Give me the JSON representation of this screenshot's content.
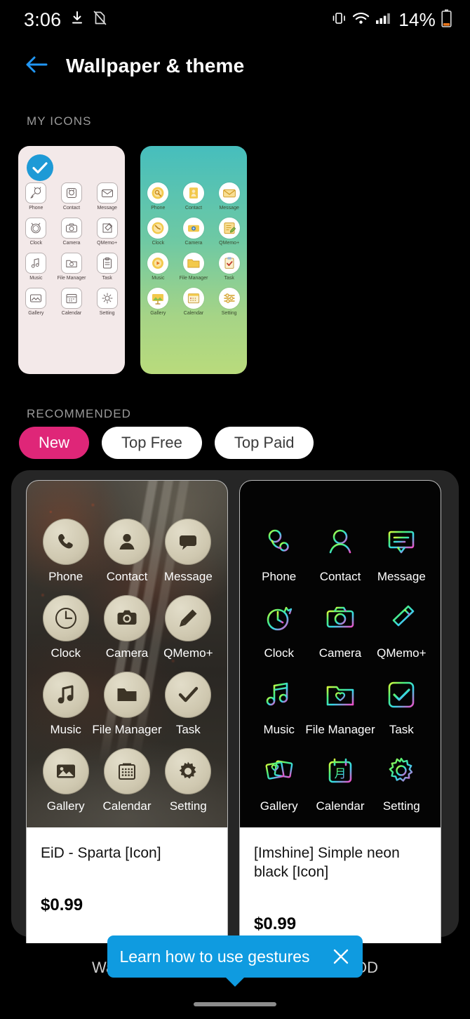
{
  "status_bar": {
    "time": "3:06",
    "battery_percent": "14%",
    "icons": [
      "download-icon",
      "document-off-icon",
      "vibrate-icon",
      "wifi-icon",
      "signal-icon",
      "battery-icon"
    ]
  },
  "header": {
    "title": "Wallpaper & theme",
    "back_icon": "arrow-left-icon",
    "accent": "#2196F3"
  },
  "my_icons": {
    "label": "MY ICONS",
    "themes": [
      {
        "name": "cat-line-art-theme",
        "selected": true,
        "bg": "#F3E9E9",
        "apps": [
          "Phone",
          "Contact",
          "Message",
          "Clock",
          "Camera",
          "QMemo+",
          "Music",
          "File Manager",
          "Task",
          "Gallery",
          "Calendar",
          "Setting"
        ]
      },
      {
        "name": "teal-gold-theme",
        "selected": false,
        "bg_top": "#46BEBD",
        "bg_bottom": "#B9DB7C",
        "apps": [
          "Phone",
          "Contact",
          "Message",
          "Clock",
          "Camera",
          "QMemo+",
          "Music",
          "File Manager",
          "Task",
          "Gallery",
          "Calendar",
          "Setting"
        ]
      }
    ]
  },
  "recommended": {
    "label": "RECOMMENDED",
    "active_color": "#DF2678",
    "chips": [
      {
        "label": "New",
        "active": true
      },
      {
        "label": "Top Free",
        "active": false
      },
      {
        "label": "Top Paid",
        "active": false
      }
    ],
    "products": [
      {
        "title": "EiD - Sparta [Icon]",
        "price": "$0.99",
        "style": "stone",
        "apps": [
          "Phone",
          "Contact",
          "Message",
          "Clock",
          "Camera",
          "QMemo+",
          "Music",
          "File Manager",
          "Task",
          "Gallery",
          "Calendar",
          "Setting"
        ]
      },
      {
        "title": "[Imshine] Simple neon black [Icon]",
        "price": "$0.99",
        "style": "neon",
        "calendar_glyph": "月",
        "apps": [
          "Phone",
          "Contact",
          "Message",
          "Clock",
          "Camera",
          "QMemo+",
          "Music",
          "File Manager",
          "Task",
          "Gallery",
          "Calendar",
          "Setting"
        ]
      }
    ]
  },
  "tooltip": {
    "text": "Learn how to use gestures",
    "close_icon": "close-icon",
    "color": "#0F9BE0"
  },
  "bottom_nav": {
    "items": [
      {
        "label": "Wallpaper"
      },
      {
        "label": "AOD"
      }
    ]
  }
}
